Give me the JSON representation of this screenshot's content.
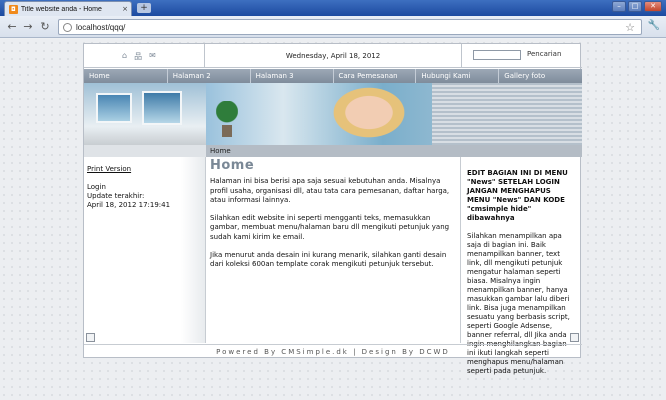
{
  "browser": {
    "tab_title": "Title website anda - Home",
    "tab_close": "×",
    "new_tab": "+",
    "url": "localhost/qqq/",
    "win_minimize": "–",
    "win_maximize": "□",
    "win_close": "✕",
    "back": "←",
    "forward": "→",
    "reload": "↻",
    "star": "☆",
    "wrench": "🔧"
  },
  "site": {
    "top_icons": [
      "⌂",
      "品",
      "✉"
    ],
    "date": "Wednesday, April 18, 2012",
    "search_button": "Pencarian",
    "menu": [
      "Home",
      "Halaman 2",
      "Halaman 3",
      "Cara Pemesanan",
      "Hubungi Kami",
      "Gallery foto"
    ],
    "breadcrumb": "Home",
    "left": {
      "print_version": "Print Version",
      "login": "Login",
      "updated_label": "Update terakhir:",
      "updated_value": "April 18, 2012 17:19:41"
    },
    "main": {
      "heading": "Home",
      "p1": "Halaman ini bisa berisi apa saja sesuai kebutuhan anda. Misalnya profil usaha, organisasi dll, atau tata cara pemesanan, daftar harga, atau informasi lainnya.",
      "p2": "Silahkan edit website ini seperti mengganti teks, memasukkan gambar, membuat menu/halaman baru dll mengikuti petunjuk yang sudah kami kirim ke email.",
      "p3": "Jika menurut anda desain ini kurang menarik, silahkan ganti desain dari koleksi 600an template corak mengikuti petunjuk tersebut."
    },
    "right": {
      "bold_text": "EDIT BAGIAN INI DI MENU \"News\" SETELAH LOGIN JANGAN MENGHAPUS MENU \"News\" DAN KODE \"cmsimple hide\" dibawahnya",
      "body": "Silahkan menampilkan apa saja di bagian ini. Baik menampilkan banner, text link, dll mengikuti petunjuk mengatur halaman seperti biasa. Misalnya ingin menampilkan banner, hanya masukkan gambar lalu diberi link. Bisa juga menampilkan sesuatu yang berbasis script, seperti Google Adsense, banner referral, dll Jika anda ingin menghilangkan bagian ini ikuti langkah seperti menghapus menu/halaman seperti pada petunjuk."
    },
    "footer": "Powered By CMSimple.dk | Design By DCWD"
  }
}
